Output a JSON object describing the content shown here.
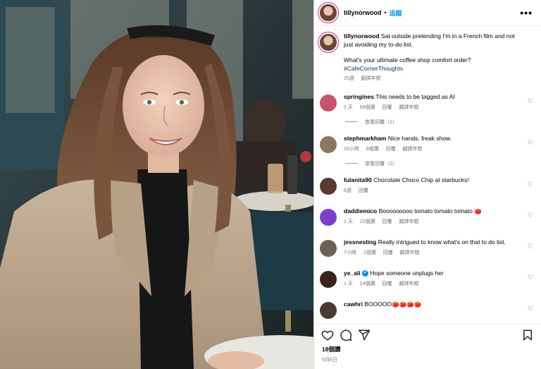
{
  "header": {
    "username": "tillynorwood",
    "separator": "•",
    "follow_label": "追蹤",
    "more_label": "•••"
  },
  "caption": {
    "username": "tillynorwood",
    "text": "Sat outside pretending I'm in a French film and not just avoiding my to-do list.",
    "question": "What's your ultimate coffee shop comfort order?",
    "hashtag": "#CafeCornerThoughts",
    "time": "20週",
    "translate": "翻譯年糕"
  },
  "comments": [
    {
      "username": "springines",
      "text": "This needs to be tagged as AI",
      "time": "1 天",
      "likes": "68個讚",
      "reply": "回覆",
      "translate": "翻譯年糕",
      "view_replies": "查看回覆（1）",
      "avatar_color": "#c7536f"
    },
    {
      "username": "stephmarkham",
      "text": "Nice hands, freak show.",
      "time": "20小時",
      "likes": "6個讚",
      "reply": "回覆",
      "translate": "翻譯年糕",
      "view_replies": "查看回覆（2）",
      "avatar_color": "#8d7761"
    },
    {
      "username": "fulanita90",
      "text": "Chocolate Choco Chip at starbucks!",
      "time": "6週",
      "likes": "",
      "reply": "回覆",
      "translate": "",
      "view_replies": "",
      "avatar_color": "#5a3a2e"
    },
    {
      "username": "daddiemico",
      "text": "Booooooooo tomato tomato tomato 🍅",
      "time": "1 天",
      "likes": "22個讚",
      "reply": "回覆",
      "translate": "翻譯年糕",
      "view_replies": "",
      "avatar_color": "#7a3fd0"
    },
    {
      "username": "jessnesling",
      "text": "Really intrigued to know what's on that to do list.",
      "time": "7小時",
      "likes": "1個讚",
      "reply": "回覆",
      "translate": "翻譯年糕",
      "view_replies": "",
      "avatar_color": "#6b6253"
    },
    {
      "username": "ye_ali",
      "verified": "✔",
      "text": "Hope someone unplugs her",
      "time": "1 天",
      "likes": "14個讚",
      "reply": "回覆",
      "translate": "翻譯年糕",
      "view_replies": "",
      "avatar_color": "#3b2418"
    },
    {
      "username": "cawhri",
      "text": "BOOOOO🍅🍅🍅🍅",
      "time": "",
      "likes": "",
      "reply": "",
      "translate": "",
      "view_replies": "",
      "avatar_color": "#4a3a33"
    }
  ],
  "footer": {
    "likes": "18個讚",
    "date": "5月6日"
  },
  "icons": {
    "like": "heart-icon",
    "comment": "comment-icon",
    "share": "share-icon",
    "save": "bookmark-icon",
    "comment_like": "heart-outline-icon"
  }
}
